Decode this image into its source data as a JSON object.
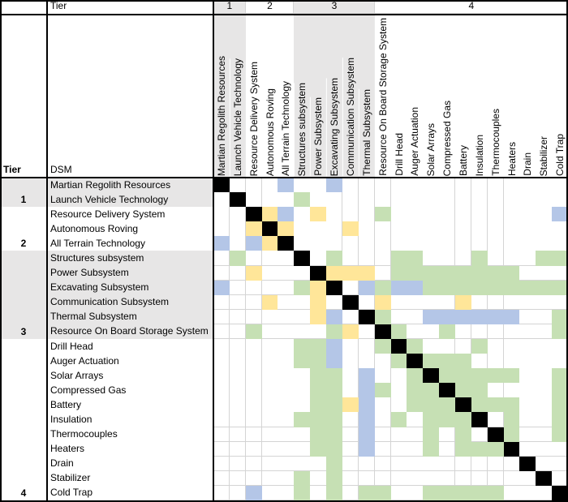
{
  "header": {
    "tier_label": "Tier",
    "corner_tier": "Tier",
    "dsm_label": "DSM"
  },
  "tier_groups": [
    {
      "label": "1",
      "start": 0,
      "end": 1,
      "shaded": true
    },
    {
      "label": "2",
      "start": 2,
      "end": 4,
      "shaded": false
    },
    {
      "label": "3",
      "start": 5,
      "end": 9,
      "shaded": true
    },
    {
      "label": "4",
      "start": 10,
      "end": 21,
      "shaded": false
    }
  ],
  "items": [
    "Martian Regolith Resources",
    "Launch Vehicle Technology",
    "Resource Delivery System",
    "Autonomous Roving",
    "All Terrain Technology",
    "Structures subsystem",
    "Power Subsystem",
    "Excavating Subsystem",
    "Communication Subsystem",
    "Thermal Subsystem",
    "Resource On Board Storage System",
    "Drill Head",
    "Auger Actuation",
    "Solar Arrays",
    "Compressed Gas",
    "Battery",
    "Insulation",
    "Thermocouples",
    "Heaters",
    "Drain",
    "Stabilizer",
    "Cold Trap"
  ],
  "row_tiers": [
    {
      "label": "1",
      "row": 1,
      "start": 0,
      "end": 1,
      "shaded": true
    },
    {
      "label": "2",
      "row": 4,
      "start": 2,
      "end": 4,
      "shaded": false
    },
    {
      "label": "3",
      "row": 10,
      "start": 5,
      "end": 10,
      "shaded": true
    },
    {
      "label": "4",
      "row": 21,
      "start": 11,
      "end": 21,
      "shaded": false
    }
  ],
  "legend_colors": {
    "X": "#000000",
    "b": "#b4c6e7",
    "y": "#ffe699",
    "g": "#c6e0b4",
    "shade": "#e7e6e6"
  },
  "matrix": [
    "X...b..b..............",
    ".X...g................",
    "..Xyb.y...g..........b",
    "..yXy...y.............",
    "b.byX.................",
    ".g...X.g...gg...g...gg",
    "..y...Xyyy.gggggggg...",
    "b....gyX.bgbbggggggggg",
    "...y..y.X.y....y......",
    "......yb.Xg..bbbbbb..g",
    "..g....gy.Xg..g......g",
    ".....ggb..gXg...g.....",
    ".....ggb...gXggg......",
    "......gg.b..gXggggg..g",
    "......gg.bg.ggXgg....g",
    "......ggyb..gggXggg..g",
    ".....ggg.b.g.gggX.g..g",
    "......gg.b...g.g.Xg..g",
    "......gg.b...g.gggX...",
    ".......g...........X..",
    ".....g.g............X.",
    "..b..g.g.gg..ggggg...X"
  ]
}
